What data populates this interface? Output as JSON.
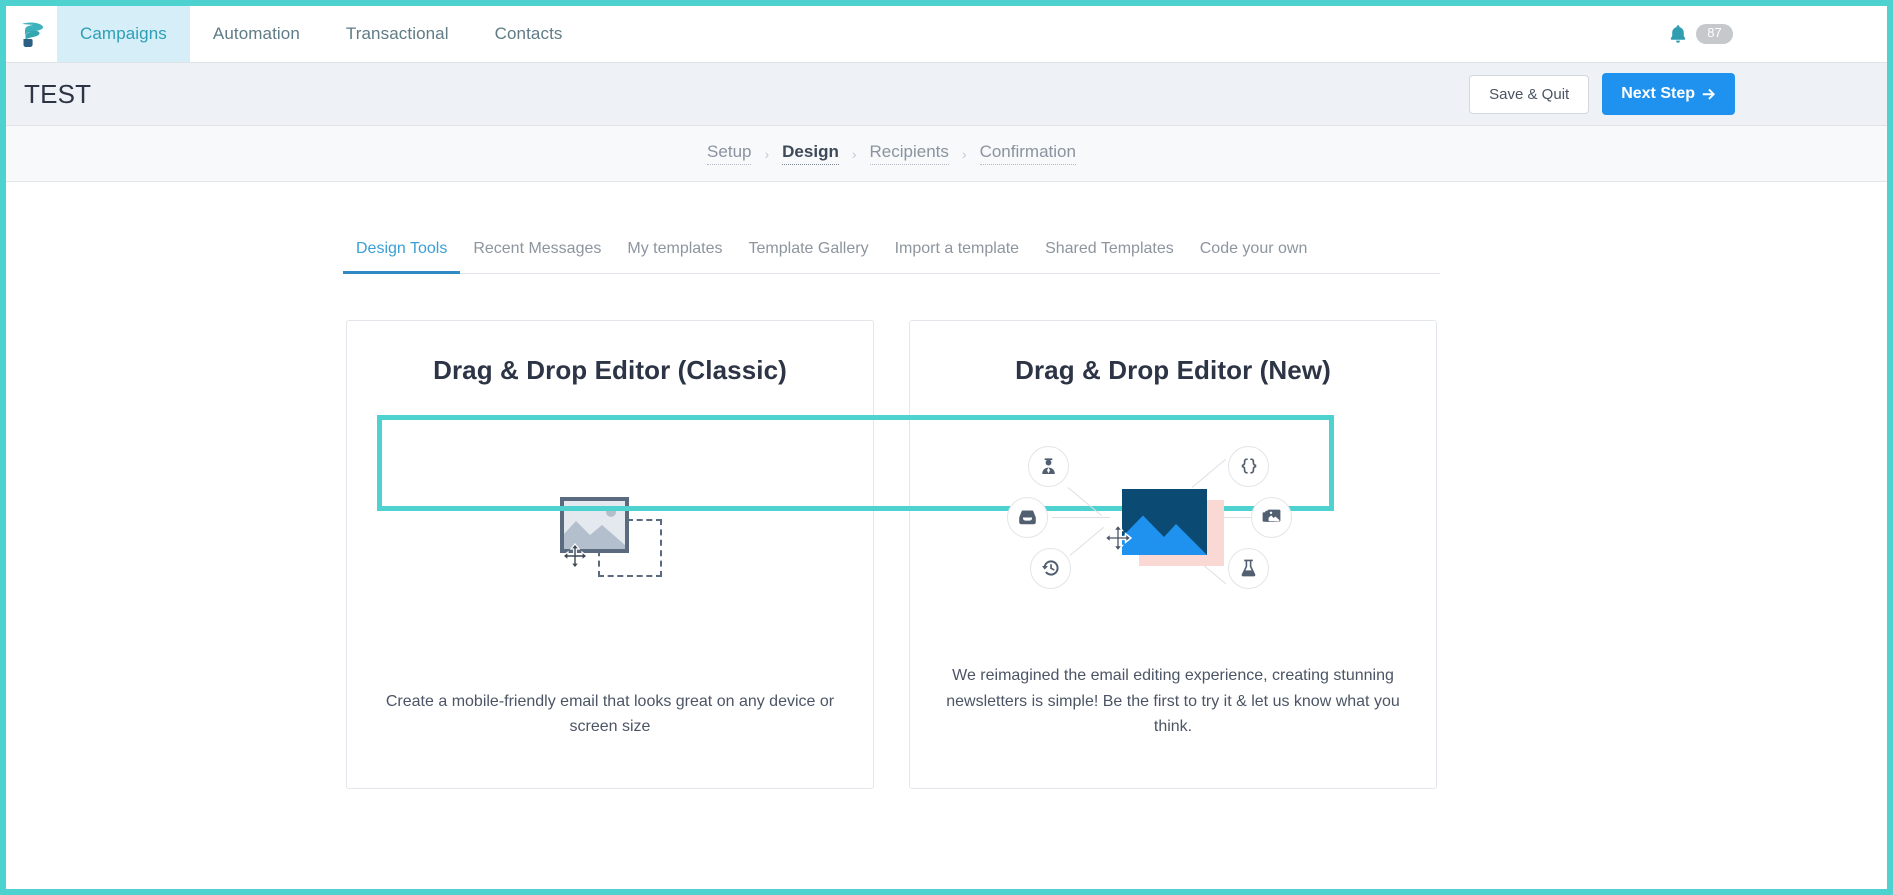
{
  "theme": {
    "accent_teal": "#4ed2d0",
    "nav_active_bg": "#d6eef7",
    "nav_active_text": "#2c9fb5",
    "primary_button_bg": "#1f92f0",
    "header_bg": "#eef1f5",
    "tab_active": "#3b9fd6",
    "art_navy": "#0b4a72",
    "art_blue": "#1f92f0",
    "art_pink": "#fad9d4",
    "icon_gray": "#5b6b7f"
  },
  "topnav": {
    "logo_icon": "sendinblue-bird-logo-icon",
    "items": [
      {
        "label": "Campaigns",
        "active": true
      },
      {
        "label": "Automation",
        "active": false
      },
      {
        "label": "Transactional",
        "active": false
      },
      {
        "label": "Contacts",
        "active": false
      }
    ],
    "bell_icon": "notification-bell-icon",
    "notification_count": "87"
  },
  "header": {
    "title": "TEST",
    "save_quit_label": "Save & Quit",
    "next_step_label": "Next Step",
    "next_step_icon": "arrow-right-icon"
  },
  "steps": {
    "separator": "›",
    "items": [
      {
        "label": "Setup",
        "active": false
      },
      {
        "label": "Design",
        "active": true
      },
      {
        "label": "Recipients",
        "active": false
      },
      {
        "label": "Confirmation",
        "active": false
      }
    ]
  },
  "tabs": [
    {
      "label": "Design Tools",
      "active": true
    },
    {
      "label": "Recent Messages",
      "active": false
    },
    {
      "label": "My templates",
      "active": false
    },
    {
      "label": "Template Gallery",
      "active": false
    },
    {
      "label": "Import a template",
      "active": false
    },
    {
      "label": "Shared Templates",
      "active": false
    },
    {
      "label": "Code your own",
      "active": false
    }
  ],
  "cards": [
    {
      "title": "Drag & Drop Editor (Classic)",
      "description": "Create a mobile-friendly email that looks great on any device or screen size",
      "art": "image-placeholder-drag-drop-illustration"
    },
    {
      "title": "Drag & Drop Editor (New)",
      "description": "We reimagined the email editing experience, creating stunning newsletters is simple! Be the first to try it & let us know what you think.",
      "art": "new-editor-node-network-illustration",
      "node_icons": [
        "user-tie-icon",
        "inbox-icon",
        "history-clock-icon",
        "code-braces-icon",
        "images-gallery-icon",
        "flask-ab-test-icon"
      ]
    }
  ],
  "annotations": [
    {
      "name": "tabs-highlight-box",
      "color": "#4ed2d0"
    },
    {
      "name": "screenshot-border-box",
      "color": "#4ed2d0"
    }
  ]
}
